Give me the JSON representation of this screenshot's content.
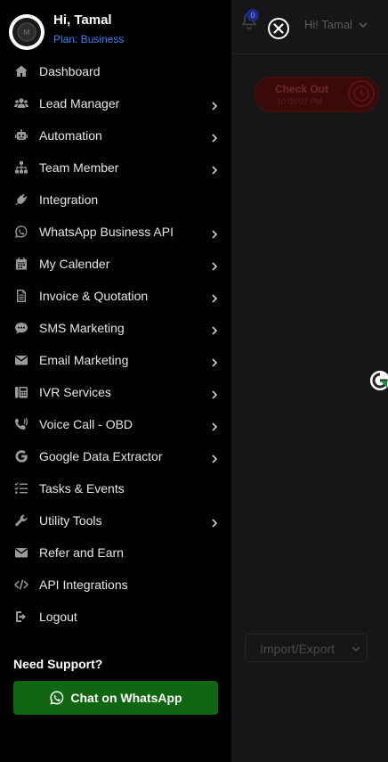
{
  "profile": {
    "greeting": "Hi, Tamal",
    "plan": "Plan: Business"
  },
  "menu": [
    {
      "label": "Dashboard",
      "icon": "home-icon",
      "has_submenu": false
    },
    {
      "label": "Lead Manager",
      "icon": "users-icon",
      "has_submenu": true
    },
    {
      "label": "Automation",
      "icon": "robot-icon",
      "has_submenu": true
    },
    {
      "label": "Team Member",
      "icon": "sitemap-icon",
      "has_submenu": true
    },
    {
      "label": "Integration",
      "icon": "plug-icon",
      "has_submenu": false
    },
    {
      "label": "WhatsApp Business API",
      "icon": "whatsapp-icon",
      "has_submenu": true
    },
    {
      "label": "My Calender",
      "icon": "calendar-icon",
      "has_submenu": true
    },
    {
      "label": "Invoice & Quotation",
      "icon": "document-icon",
      "has_submenu": true
    },
    {
      "label": "SMS Marketing",
      "icon": "chat-bubble-icon",
      "has_submenu": true
    },
    {
      "label": "Email Marketing",
      "icon": "envelope-icon",
      "has_submenu": true
    },
    {
      "label": "IVR Services",
      "icon": "fax-icon",
      "has_submenu": true
    },
    {
      "label": "Voice Call - OBD",
      "icon": "phone-wave-icon",
      "has_submenu": true
    },
    {
      "label": "Google Data Extractor",
      "icon": "google-icon",
      "has_submenu": true
    },
    {
      "label": "Tasks & Events",
      "icon": "checklist-icon",
      "has_submenu": false
    },
    {
      "label": "Utility Tools",
      "icon": "wrench-icon",
      "has_submenu": true
    },
    {
      "label": "Refer and Earn",
      "icon": "envelope-icon",
      "has_submenu": false
    },
    {
      "label": "API Integrations",
      "icon": "code-icon",
      "has_submenu": false
    },
    {
      "label": "Logout",
      "icon": "logout-icon",
      "has_submenu": false
    }
  ],
  "support": {
    "title": "Need Support?",
    "button_label": "Chat on WhatsApp"
  },
  "background": {
    "notification_count": "0",
    "user_greeting": "Hi! Tamal",
    "checkout_label": "Check Out",
    "checkout_time": "10:00:07 PM",
    "import_export_label": "Import/Export"
  },
  "colors": {
    "drawer_bg": "#000000",
    "plan_text": "#3b82f6",
    "whatsapp_button": "#116611",
    "icon_gray": "#9a9a9a"
  }
}
